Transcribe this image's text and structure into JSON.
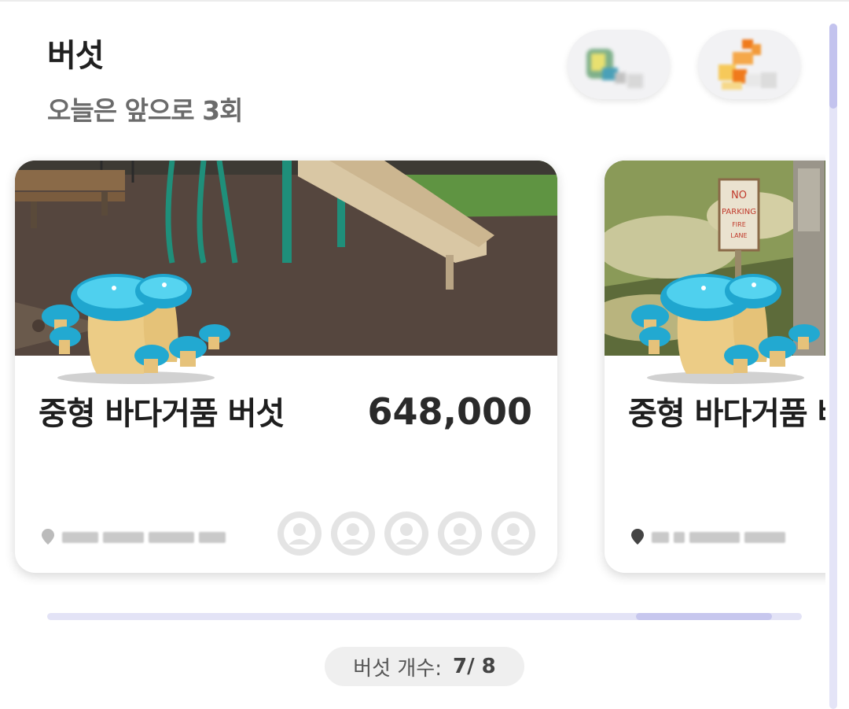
{
  "header": {
    "title": "버섯",
    "subtitle": "오늘은 앞으로 3회"
  },
  "fab_buttons": [
    {
      "icon": "sprout-item-icon"
    },
    {
      "icon": "orange-item-icon"
    }
  ],
  "cards": [
    {
      "name": "중형 바다거품 버섯",
      "price": "648,000",
      "photo": "playground-photo",
      "location_blurred": true,
      "avatar_count": 5
    },
    {
      "name": "중형 바다거품 버섯",
      "price": "",
      "photo": "no-parking-sign-photo",
      "location_blurred": true
    }
  ],
  "carousel_scroll": {
    "position": 0.78,
    "visible_fraction": 0.18
  },
  "footer": {
    "count_label": "버섯 개수:",
    "count_value": "7/ 8"
  },
  "colors": {
    "accent": "#c7c7ee",
    "track": "#e3e3f6",
    "mushroom_cap": "#29b6d6",
    "mushroom_stem": "#e8c87a"
  }
}
